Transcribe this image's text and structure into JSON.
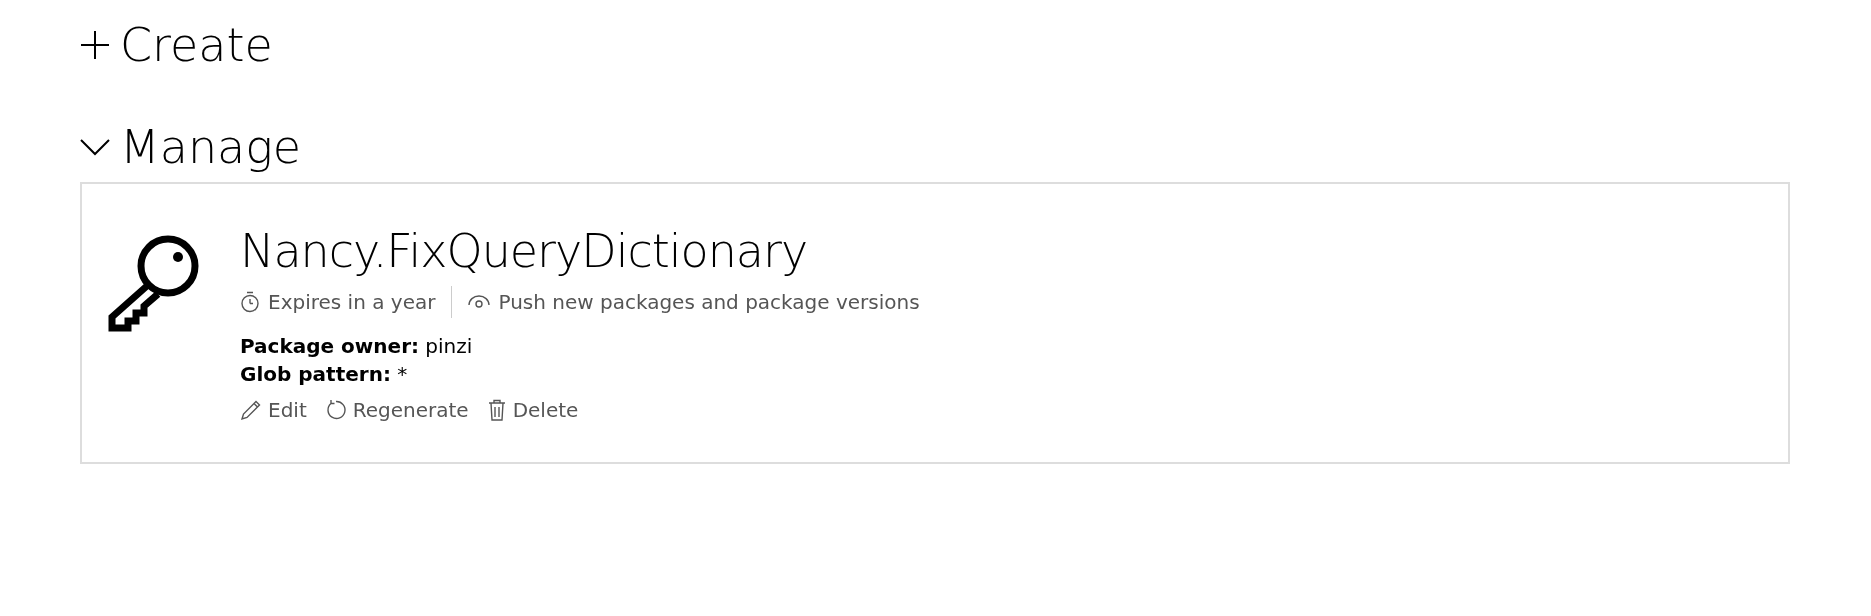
{
  "sections": [
    {
      "title": "Create",
      "expanded": false
    },
    {
      "title": "Manage",
      "expanded": true
    }
  ],
  "api_key": {
    "name": "Nancy.FixQueryDictionary",
    "expiry": "Expires in a year",
    "scope": "Push new packages and package versions",
    "fields": [
      {
        "label": "Package owner:",
        "value": "pinzi"
      },
      {
        "label": "Glob pattern:",
        "value": "*"
      }
    ],
    "actions": [
      {
        "kind": "edit",
        "label": "Edit"
      },
      {
        "kind": "regenerate",
        "label": "Regenerate"
      },
      {
        "kind": "delete",
        "label": "Delete"
      }
    ]
  }
}
